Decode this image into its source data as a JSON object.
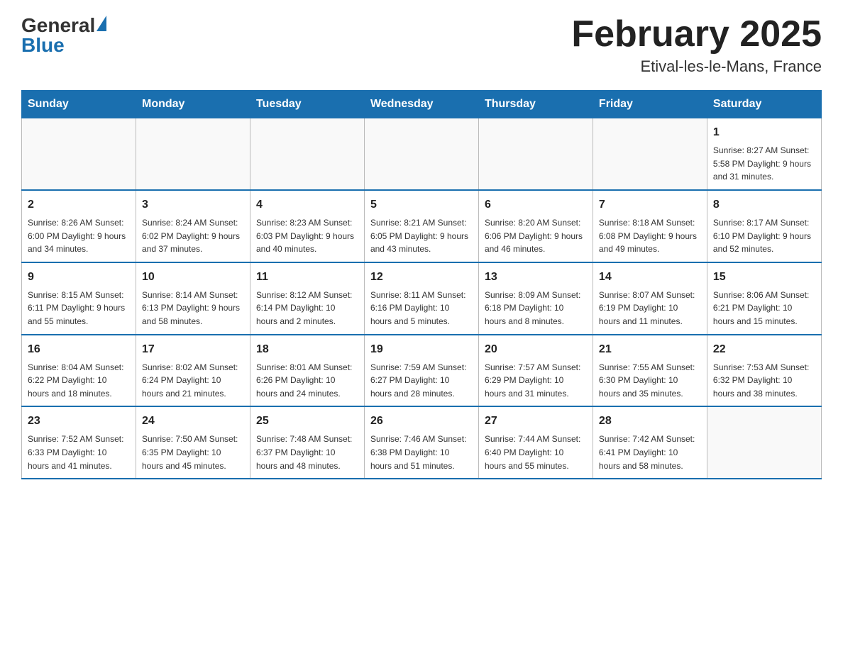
{
  "header": {
    "logo_general": "General",
    "logo_blue": "Blue",
    "title": "February 2025",
    "subtitle": "Etival-les-le-Mans, France"
  },
  "weekdays": [
    "Sunday",
    "Monday",
    "Tuesday",
    "Wednesday",
    "Thursday",
    "Friday",
    "Saturday"
  ],
  "weeks": [
    [
      {
        "day": "",
        "info": ""
      },
      {
        "day": "",
        "info": ""
      },
      {
        "day": "",
        "info": ""
      },
      {
        "day": "",
        "info": ""
      },
      {
        "day": "",
        "info": ""
      },
      {
        "day": "",
        "info": ""
      },
      {
        "day": "1",
        "info": "Sunrise: 8:27 AM\nSunset: 5:58 PM\nDaylight: 9 hours and 31 minutes."
      }
    ],
    [
      {
        "day": "2",
        "info": "Sunrise: 8:26 AM\nSunset: 6:00 PM\nDaylight: 9 hours and 34 minutes."
      },
      {
        "day": "3",
        "info": "Sunrise: 8:24 AM\nSunset: 6:02 PM\nDaylight: 9 hours and 37 minutes."
      },
      {
        "day": "4",
        "info": "Sunrise: 8:23 AM\nSunset: 6:03 PM\nDaylight: 9 hours and 40 minutes."
      },
      {
        "day": "5",
        "info": "Sunrise: 8:21 AM\nSunset: 6:05 PM\nDaylight: 9 hours and 43 minutes."
      },
      {
        "day": "6",
        "info": "Sunrise: 8:20 AM\nSunset: 6:06 PM\nDaylight: 9 hours and 46 minutes."
      },
      {
        "day": "7",
        "info": "Sunrise: 8:18 AM\nSunset: 6:08 PM\nDaylight: 9 hours and 49 minutes."
      },
      {
        "day": "8",
        "info": "Sunrise: 8:17 AM\nSunset: 6:10 PM\nDaylight: 9 hours and 52 minutes."
      }
    ],
    [
      {
        "day": "9",
        "info": "Sunrise: 8:15 AM\nSunset: 6:11 PM\nDaylight: 9 hours and 55 minutes."
      },
      {
        "day": "10",
        "info": "Sunrise: 8:14 AM\nSunset: 6:13 PM\nDaylight: 9 hours and 58 minutes."
      },
      {
        "day": "11",
        "info": "Sunrise: 8:12 AM\nSunset: 6:14 PM\nDaylight: 10 hours and 2 minutes."
      },
      {
        "day": "12",
        "info": "Sunrise: 8:11 AM\nSunset: 6:16 PM\nDaylight: 10 hours and 5 minutes."
      },
      {
        "day": "13",
        "info": "Sunrise: 8:09 AM\nSunset: 6:18 PM\nDaylight: 10 hours and 8 minutes."
      },
      {
        "day": "14",
        "info": "Sunrise: 8:07 AM\nSunset: 6:19 PM\nDaylight: 10 hours and 11 minutes."
      },
      {
        "day": "15",
        "info": "Sunrise: 8:06 AM\nSunset: 6:21 PM\nDaylight: 10 hours and 15 minutes."
      }
    ],
    [
      {
        "day": "16",
        "info": "Sunrise: 8:04 AM\nSunset: 6:22 PM\nDaylight: 10 hours and 18 minutes."
      },
      {
        "day": "17",
        "info": "Sunrise: 8:02 AM\nSunset: 6:24 PM\nDaylight: 10 hours and 21 minutes."
      },
      {
        "day": "18",
        "info": "Sunrise: 8:01 AM\nSunset: 6:26 PM\nDaylight: 10 hours and 24 minutes."
      },
      {
        "day": "19",
        "info": "Sunrise: 7:59 AM\nSunset: 6:27 PM\nDaylight: 10 hours and 28 minutes."
      },
      {
        "day": "20",
        "info": "Sunrise: 7:57 AM\nSunset: 6:29 PM\nDaylight: 10 hours and 31 minutes."
      },
      {
        "day": "21",
        "info": "Sunrise: 7:55 AM\nSunset: 6:30 PM\nDaylight: 10 hours and 35 minutes."
      },
      {
        "day": "22",
        "info": "Sunrise: 7:53 AM\nSunset: 6:32 PM\nDaylight: 10 hours and 38 minutes."
      }
    ],
    [
      {
        "day": "23",
        "info": "Sunrise: 7:52 AM\nSunset: 6:33 PM\nDaylight: 10 hours and 41 minutes."
      },
      {
        "day": "24",
        "info": "Sunrise: 7:50 AM\nSunset: 6:35 PM\nDaylight: 10 hours and 45 minutes."
      },
      {
        "day": "25",
        "info": "Sunrise: 7:48 AM\nSunset: 6:37 PM\nDaylight: 10 hours and 48 minutes."
      },
      {
        "day": "26",
        "info": "Sunrise: 7:46 AM\nSunset: 6:38 PM\nDaylight: 10 hours and 51 minutes."
      },
      {
        "day": "27",
        "info": "Sunrise: 7:44 AM\nSunset: 6:40 PM\nDaylight: 10 hours and 55 minutes."
      },
      {
        "day": "28",
        "info": "Sunrise: 7:42 AM\nSunset: 6:41 PM\nDaylight: 10 hours and 58 minutes."
      },
      {
        "day": "",
        "info": ""
      }
    ]
  ]
}
